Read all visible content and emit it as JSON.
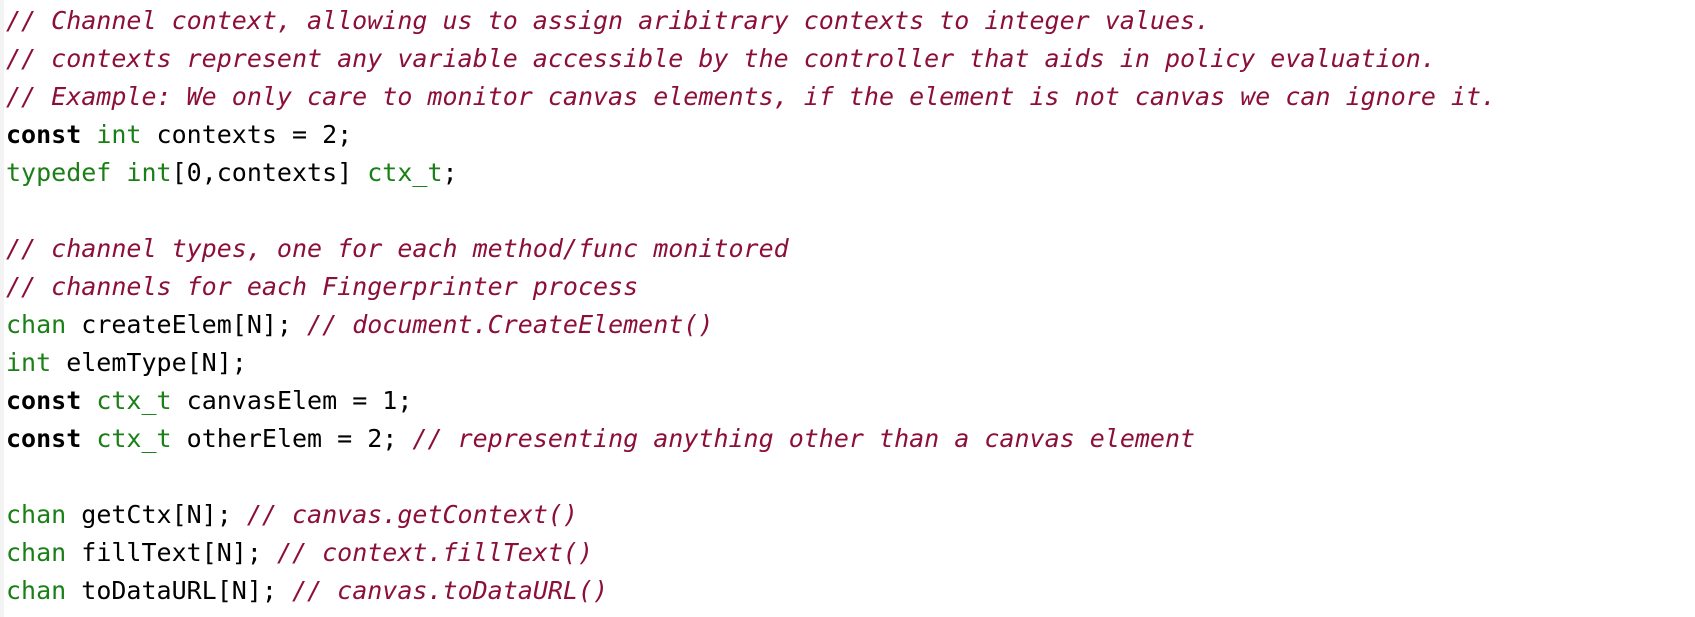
{
  "colors": {
    "comment": "#8c0f3a",
    "keyword": "#000000",
    "type": "#1a7f16",
    "text": "#000000",
    "background": "#ffffff"
  },
  "lines": [
    [
      {
        "kind": "comment",
        "text": "// Channel context, allowing us to assign aribitrary contexts to integer values."
      }
    ],
    [
      {
        "kind": "comment",
        "text": "// contexts represent any variable accessible by the controller that aids in policy evaluation."
      }
    ],
    [
      {
        "kind": "comment",
        "text": "// Example: We only care to monitor canvas elements, if the element is not canvas we can ignore it."
      }
    ],
    [
      {
        "kind": "kw",
        "text": "const"
      },
      {
        "kind": "plain",
        "text": " "
      },
      {
        "kind": "type",
        "text": "int"
      },
      {
        "kind": "plain",
        "text": " contexts = 2;"
      }
    ],
    [
      {
        "kind": "type",
        "text": "typedef"
      },
      {
        "kind": "plain",
        "text": " "
      },
      {
        "kind": "type",
        "text": "int"
      },
      {
        "kind": "plain",
        "text": "[0,contexts] "
      },
      {
        "kind": "type",
        "text": "ctx_t"
      },
      {
        "kind": "plain",
        "text": ";"
      }
    ],
    [],
    [
      {
        "kind": "comment",
        "text": "// channel types, one for each method/func monitored"
      }
    ],
    [
      {
        "kind": "comment",
        "text": "// channels for each Fingerprinter process"
      }
    ],
    [
      {
        "kind": "type",
        "text": "chan"
      },
      {
        "kind": "plain",
        "text": " createElem[N]; "
      },
      {
        "kind": "comment",
        "text": "// document.CreateElement()"
      }
    ],
    [
      {
        "kind": "type",
        "text": "int"
      },
      {
        "kind": "plain",
        "text": " elemType[N];"
      }
    ],
    [
      {
        "kind": "kw",
        "text": "const"
      },
      {
        "kind": "plain",
        "text": " "
      },
      {
        "kind": "type",
        "text": "ctx_t"
      },
      {
        "kind": "plain",
        "text": " canvasElem = 1;"
      }
    ],
    [
      {
        "kind": "kw",
        "text": "const"
      },
      {
        "kind": "plain",
        "text": " "
      },
      {
        "kind": "type",
        "text": "ctx_t"
      },
      {
        "kind": "plain",
        "text": " otherElem = 2; "
      },
      {
        "kind": "comment",
        "text": "// representing anything other than a canvas element"
      }
    ],
    [],
    [
      {
        "kind": "type",
        "text": "chan"
      },
      {
        "kind": "plain",
        "text": " getCtx[N]; "
      },
      {
        "kind": "comment",
        "text": "// canvas.getContext()"
      }
    ],
    [
      {
        "kind": "type",
        "text": "chan"
      },
      {
        "kind": "plain",
        "text": " fillText[N]; "
      },
      {
        "kind": "comment",
        "text": "// context.fillText()"
      }
    ],
    [
      {
        "kind": "type",
        "text": "chan"
      },
      {
        "kind": "plain",
        "text": " toDataURL[N]; "
      },
      {
        "kind": "comment",
        "text": "// canvas.toDataURL()"
      }
    ]
  ]
}
